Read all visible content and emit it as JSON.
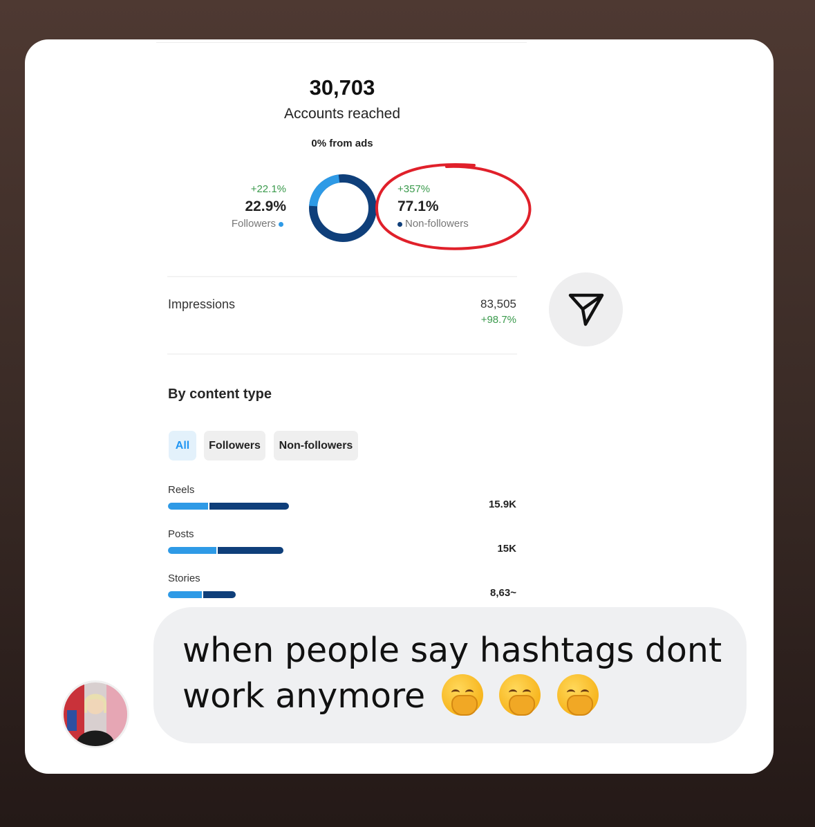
{
  "reach": {
    "total": "30,703",
    "label": "Accounts reached",
    "ads": "0% from ads"
  },
  "audience": {
    "followers": {
      "delta": "+22.1%",
      "percent": "22.9%",
      "label": "Followers",
      "fraction": 0.229,
      "color": "#2e9ae6"
    },
    "non_followers": {
      "delta": "+357%",
      "percent": "77.1%",
      "label": "Non-followers",
      "fraction": 0.771,
      "color": "#0f3f7a"
    }
  },
  "impressions": {
    "label": "Impressions",
    "value": "83,505",
    "delta": "+98.7%"
  },
  "content_type": {
    "title": "By content type",
    "tabs": [
      {
        "label": "All",
        "active": true
      },
      {
        "label": "Followers",
        "active": false
      },
      {
        "label": "Non-followers",
        "active": false
      }
    ],
    "rows": [
      {
        "label": "Reels",
        "value": "15.9K",
        "total_fraction": 0.345,
        "followers_fraction": 0.33
      },
      {
        "label": "Posts",
        "value": "15K",
        "total_fraction": 0.33,
        "followers_fraction": 0.42
      },
      {
        "label": "Stories",
        "value": "8,63~",
        "total_fraction": 0.193,
        "followers_fraction": 0.5
      }
    ]
  },
  "colors": {
    "accent_green": "#3a9a4c",
    "followers_blue": "#2e9ae6",
    "non_followers_navy": "#0f3f7a",
    "highlight_red": "#e0202a"
  },
  "share_icon": "send-icon",
  "message": {
    "text": "when people say hashtags dont work anymore",
    "emoji": [
      "face-with-hand-over-mouth",
      "face-with-hand-over-mouth",
      "face-with-hand-over-mouth"
    ]
  }
}
